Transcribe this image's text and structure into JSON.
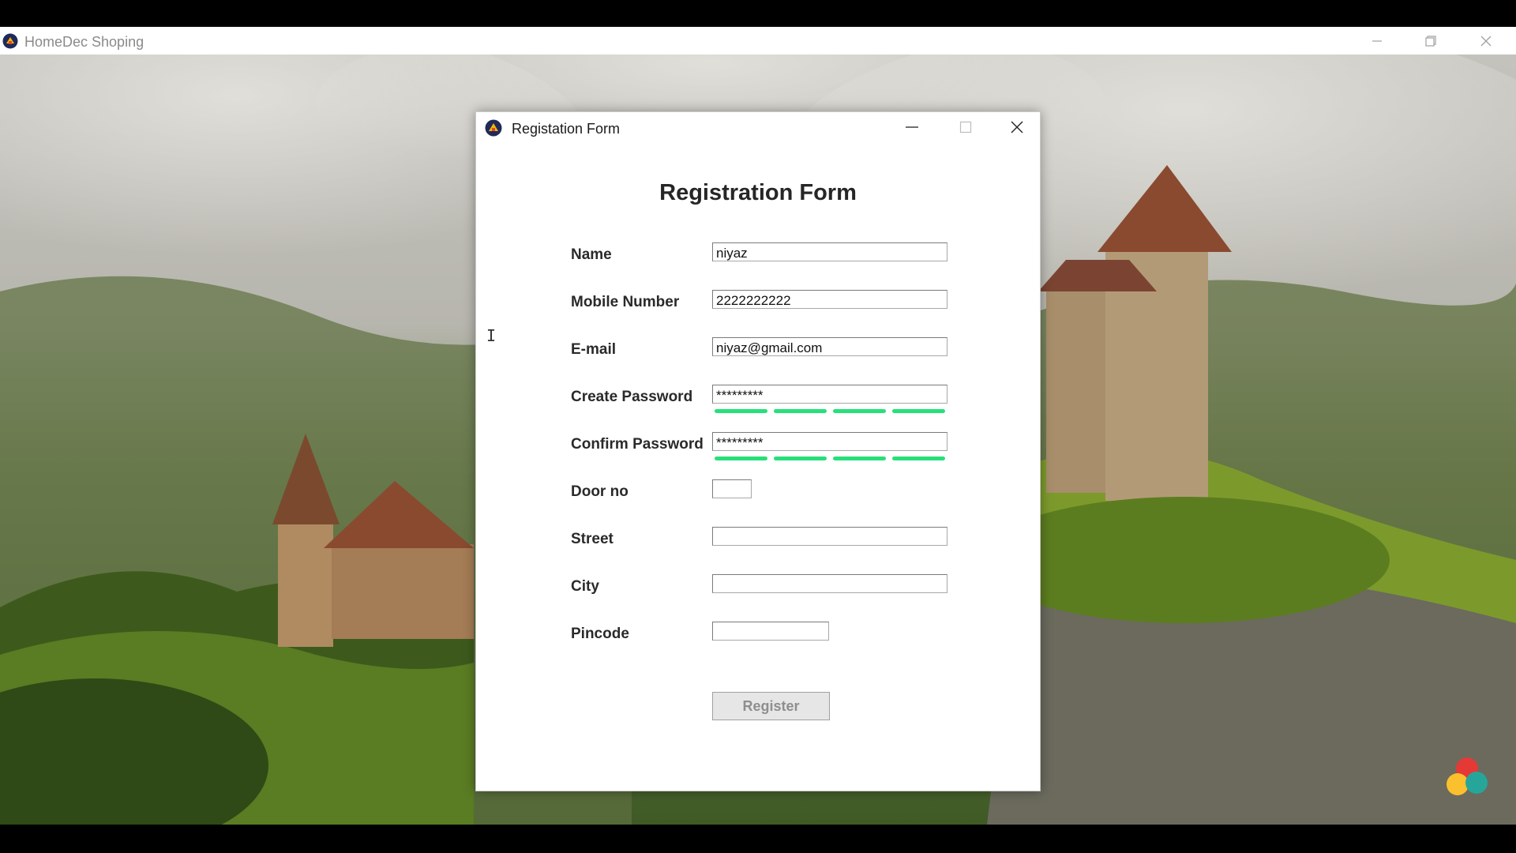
{
  "app": {
    "title": "HomeDec Shoping",
    "icon": "app-logo-icon",
    "controls": [
      "minimize-icon",
      "restore-icon",
      "close-icon"
    ]
  },
  "dialog": {
    "window_title": "Registation Form",
    "heading": "Registration Form",
    "fields": [
      {
        "label": "Name",
        "value": "niyaz"
      },
      {
        "label": "Mobile Number",
        "value": "2222222222"
      },
      {
        "label": "E-mail",
        "value": "niyaz@gmail.com"
      },
      {
        "label": "Create Password",
        "value": "*********",
        "strength_segments": 4
      },
      {
        "label": "Confirm Password",
        "value": "*********",
        "strength_segments": 4
      },
      {
        "label": "Door no",
        "value": ""
      },
      {
        "label": "Street",
        "value": ""
      },
      {
        "label": "City",
        "value": ""
      },
      {
        "label": "Pincode",
        "value": ""
      }
    ],
    "register_label": "Register"
  },
  "colors": {
    "strength_bar": "#27e07a",
    "button_disabled_text": "#8e8e8e"
  }
}
